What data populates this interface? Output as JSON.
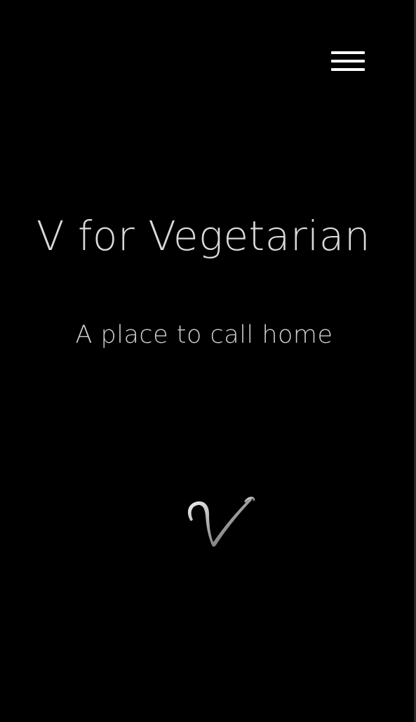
{
  "header": {
    "menu_icon": "hamburger-menu-icon"
  },
  "hero": {
    "title": "V for Vegetarian",
    "subtitle": "A place to call home"
  },
  "logo": {
    "monogram": "V",
    "icon": "script-v-monogram"
  },
  "colors": {
    "background": "#000000",
    "text": "#d9d9d9",
    "menu_lines": "#ffffff"
  }
}
